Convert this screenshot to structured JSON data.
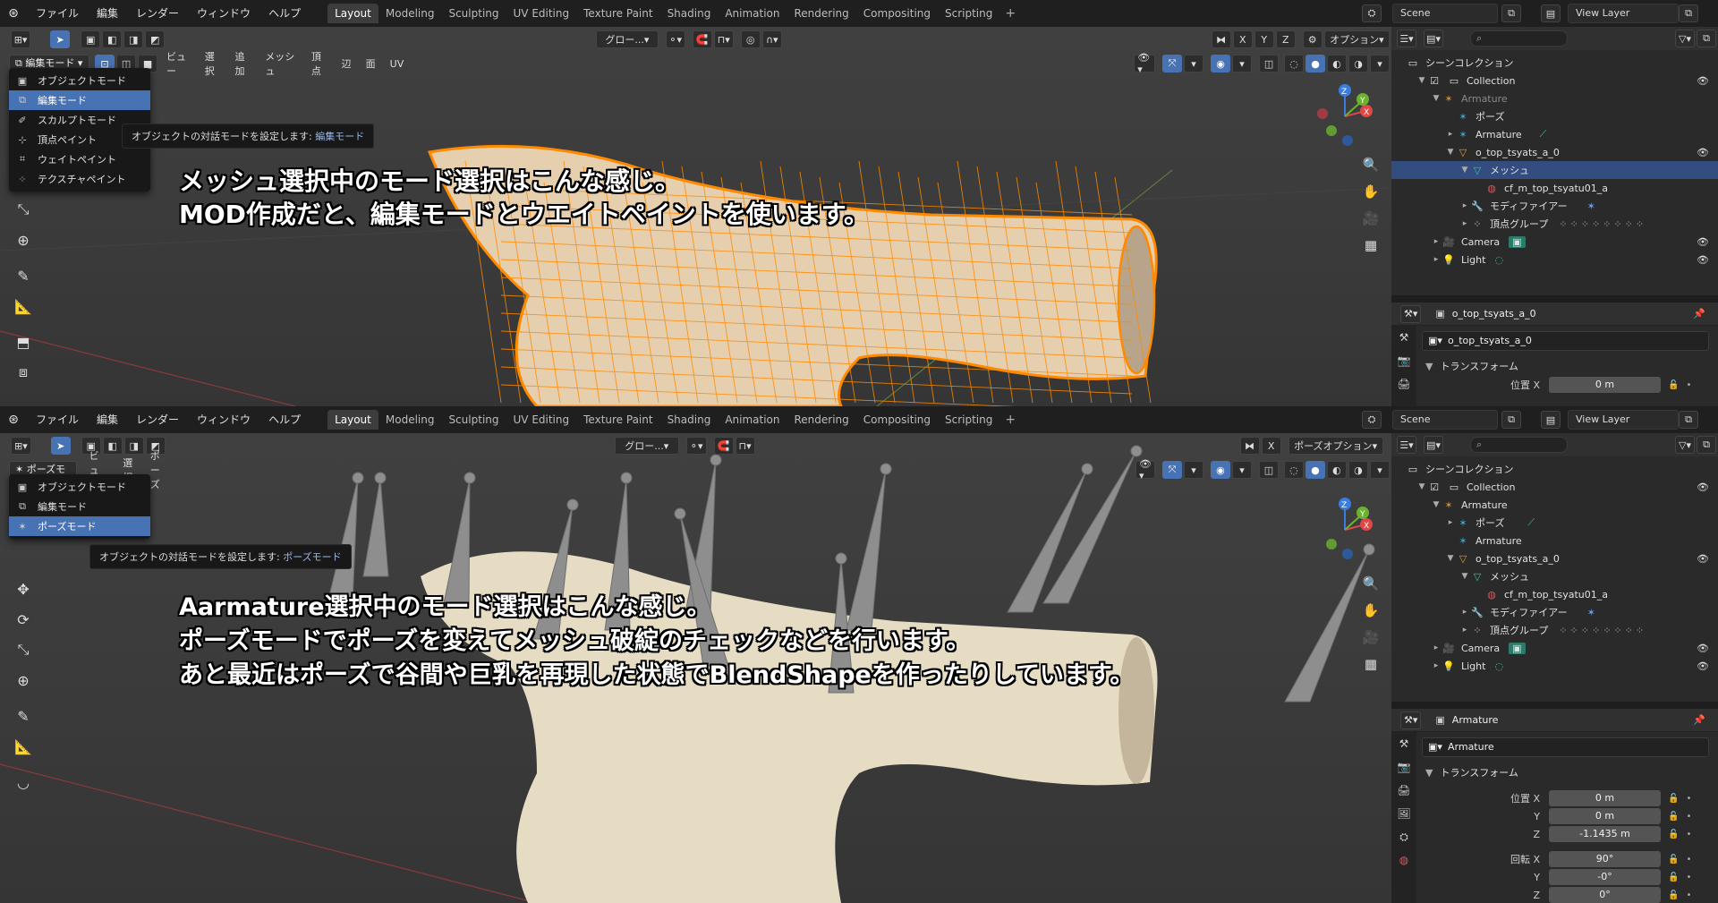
{
  "menubar": {
    "items": [
      "ファイル",
      "編集",
      "レンダー",
      "ウィンドウ",
      "ヘルプ"
    ],
    "workspaces": [
      "Layout",
      "Modeling",
      "Sculpting",
      "UV Editing",
      "Texture Paint",
      "Shading",
      "Animation",
      "Rendering",
      "Compositing",
      "Scripting"
    ],
    "active_workspace": "Layout",
    "scene": "Scene",
    "view_layer": "View Layer"
  },
  "top": {
    "mode_label": "編集モード",
    "view_menus": [
      "ビュー",
      "選択",
      "追加",
      "メッシュ",
      "頂点",
      "辺",
      "面",
      "UV"
    ],
    "transform_orientation": "グロー...",
    "axes": [
      "X",
      "Y",
      "Z"
    ],
    "options_label": "オプション",
    "dropdown": [
      {
        "label": "オブジェクトモード",
        "icon": "object-mode-icon"
      },
      {
        "label": "編集モード",
        "icon": "edit-mode-icon",
        "selected": true
      },
      {
        "label": "スカルプトモード",
        "icon": "sculpt-mode-icon"
      },
      {
        "label": "頂点ペイント",
        "icon": "vertex-paint-icon"
      },
      {
        "label": "ウェイトペイント",
        "icon": "weight-paint-icon"
      },
      {
        "label": "テクスチャペイント",
        "icon": "texture-paint-icon"
      }
    ],
    "tooltip_prefix": "オブジェクトの対話モードを設定します:",
    "tooltip_value": "編集モード",
    "annotation": [
      "メッシュ選択中のモード選択はこんな感じ。",
      "MOD作成だと、編集モードとウエイトペイントを使います。"
    ],
    "outliner": {
      "root": "シーンコレクション",
      "rows": [
        {
          "label": "Collection",
          "indent": 1
        },
        {
          "label": "Armature",
          "indent": 2,
          "dim": true
        },
        {
          "label": "ポーズ",
          "indent": 3
        },
        {
          "label": "Armature",
          "indent": 3
        },
        {
          "label": "o_top_tsyats_a_0",
          "indent": 3
        },
        {
          "label": "メッシュ",
          "indent": 4,
          "selected": true
        },
        {
          "label": "cf_m_top_tsyatu01_a",
          "indent": 5
        },
        {
          "label": "モディファイアー",
          "indent": 4
        },
        {
          "label": "頂点グループ",
          "indent": 4
        },
        {
          "label": "Camera",
          "indent": 2
        },
        {
          "label": "Light",
          "indent": 2
        }
      ]
    },
    "properties": {
      "header": "o_top_tsyats_a_0",
      "name": "o_top_tsyats_a_0",
      "section": "トランスフォーム",
      "rows": [
        {
          "label": "位置 X",
          "value": "0 m"
        }
      ]
    }
  },
  "bottom": {
    "mode_label": "ポーズモード",
    "view_menus": [
      "ビュー",
      "選択",
      "ポーズ"
    ],
    "transform_orientation": "グロー...",
    "axes": [
      "X"
    ],
    "options_label": "ポーズオプション",
    "dropdown": [
      {
        "label": "オブジェクトモード",
        "icon": "object-mode-icon"
      },
      {
        "label": "編集モード",
        "icon": "edit-mode-icon"
      },
      {
        "label": "ポーズモード",
        "icon": "pose-mode-icon",
        "selected": true
      }
    ],
    "tooltip_prefix": "オブジェクトの対話モードを設定します:",
    "tooltip_value": "ポーズモード",
    "annotation": [
      "Aarmature選択中のモード選択はこんな感じ。",
      "ポーズモードでポーズを変えてメッシュ破綻のチェックなどを行います。",
      "あと最近はポーズで谷間や巨乳を再現した状態でBlendShapeを作ったりしています。"
    ],
    "outliner": {
      "root": "シーンコレクション",
      "rows": [
        {
          "label": "Collection",
          "indent": 1
        },
        {
          "label": "Armature",
          "indent": 2
        },
        {
          "label": "ポーズ",
          "indent": 3
        },
        {
          "label": "Armature",
          "indent": 3
        },
        {
          "label": "o_top_tsyats_a_0",
          "indent": 3
        },
        {
          "label": "メッシュ",
          "indent": 4
        },
        {
          "label": "cf_m_top_tsyatu01_a",
          "indent": 5
        },
        {
          "label": "モディファイアー",
          "indent": 4
        },
        {
          "label": "頂点グループ",
          "indent": 4
        },
        {
          "label": "Camera",
          "indent": 2
        },
        {
          "label": "Light",
          "indent": 2
        }
      ]
    },
    "properties": {
      "header": "Armature",
      "name": "Armature",
      "section": "トランスフォーム",
      "rows": [
        {
          "label": "位置 X",
          "value": "0 m"
        },
        {
          "label": "Y",
          "value": "0 m"
        },
        {
          "label": "Z",
          "value": "-1.1435 m"
        },
        {
          "label": "回転 X",
          "value": "90°"
        },
        {
          "label": "Y",
          "value": "-0°"
        },
        {
          "label": "Z",
          "value": "0°"
        }
      ]
    }
  },
  "colors": {
    "selected": "#4772b3",
    "mesh_edge": "#ff8a00",
    "mesh_fill": "#e8d2b4",
    "bone": "#8a8a8a"
  }
}
